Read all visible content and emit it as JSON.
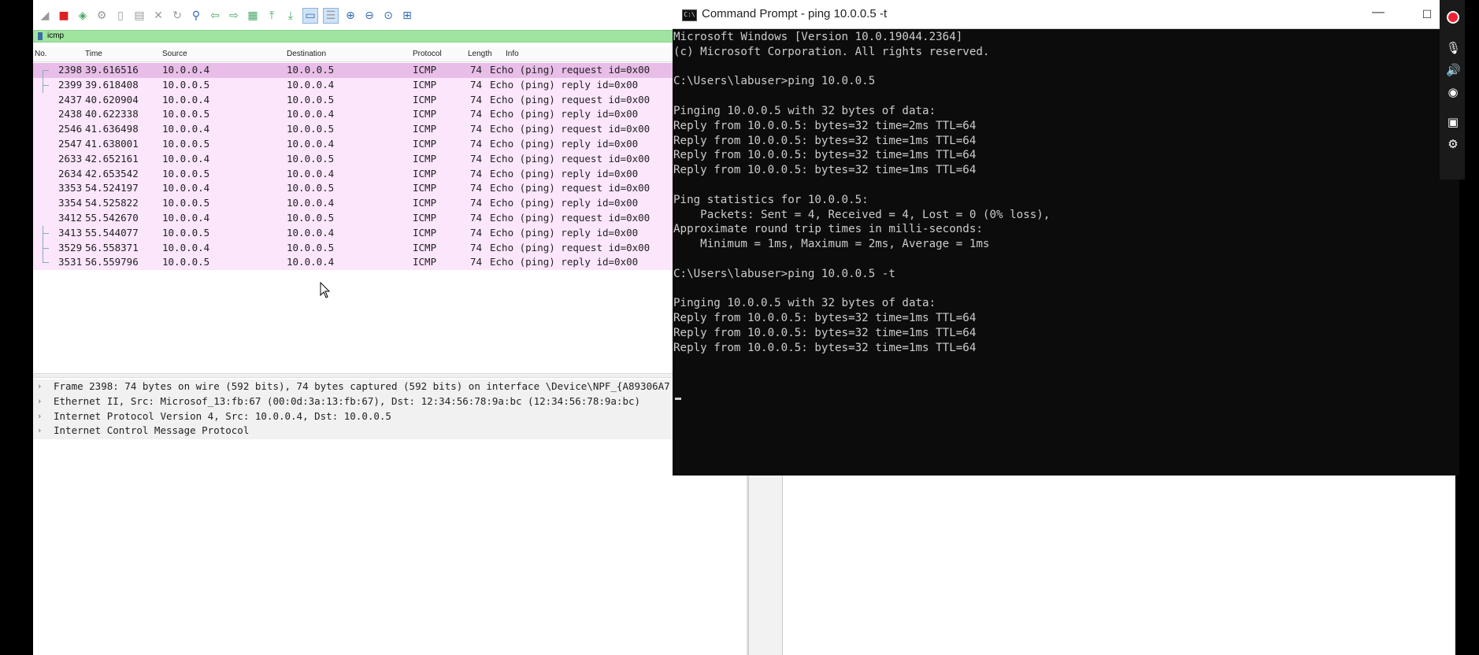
{
  "wireshark": {
    "filter": "icmp",
    "columns": {
      "no": "No.",
      "time": "Time",
      "source": "Source",
      "destination": "Destination",
      "protocol": "Protocol",
      "length": "Length",
      "info": "Info"
    },
    "packets": [
      {
        "no": "2398",
        "time": "39.616516",
        "src": "10.0.0.4",
        "dst": "10.0.0.5",
        "proto": "ICMP",
        "len": "74",
        "info": "Echo (ping) request  id=0x00"
      },
      {
        "no": "2399",
        "time": "39.618408",
        "src": "10.0.0.5",
        "dst": "10.0.0.4",
        "proto": "ICMP",
        "len": "74",
        "info": "Echo (ping) reply    id=0x00"
      },
      {
        "no": "2437",
        "time": "40.620904",
        "src": "10.0.0.4",
        "dst": "10.0.0.5",
        "proto": "ICMP",
        "len": "74",
        "info": "Echo (ping) request  id=0x00"
      },
      {
        "no": "2438",
        "time": "40.622338",
        "src": "10.0.0.5",
        "dst": "10.0.0.4",
        "proto": "ICMP",
        "len": "74",
        "info": "Echo (ping) reply    id=0x00"
      },
      {
        "no": "2546",
        "time": "41.636498",
        "src": "10.0.0.4",
        "dst": "10.0.0.5",
        "proto": "ICMP",
        "len": "74",
        "info": "Echo (ping) request  id=0x00"
      },
      {
        "no": "2547",
        "time": "41.638001",
        "src": "10.0.0.5",
        "dst": "10.0.0.4",
        "proto": "ICMP",
        "len": "74",
        "info": "Echo (ping) reply    id=0x00"
      },
      {
        "no": "2633",
        "time": "42.652161",
        "src": "10.0.0.4",
        "dst": "10.0.0.5",
        "proto": "ICMP",
        "len": "74",
        "info": "Echo (ping) request  id=0x00"
      },
      {
        "no": "2634",
        "time": "42.653542",
        "src": "10.0.0.5",
        "dst": "10.0.0.4",
        "proto": "ICMP",
        "len": "74",
        "info": "Echo (ping) reply    id=0x00"
      },
      {
        "no": "3353",
        "time": "54.524197",
        "src": "10.0.0.4",
        "dst": "10.0.0.5",
        "proto": "ICMP",
        "len": "74",
        "info": "Echo (ping) request  id=0x00"
      },
      {
        "no": "3354",
        "time": "54.525822",
        "src": "10.0.0.5",
        "dst": "10.0.0.4",
        "proto": "ICMP",
        "len": "74",
        "info": "Echo (ping) reply    id=0x00"
      },
      {
        "no": "3412",
        "time": "55.542670",
        "src": "10.0.0.4",
        "dst": "10.0.0.5",
        "proto": "ICMP",
        "len": "74",
        "info": "Echo (ping) request  id=0x00"
      },
      {
        "no": "3413",
        "time": "55.544077",
        "src": "10.0.0.5",
        "dst": "10.0.0.4",
        "proto": "ICMP",
        "len": "74",
        "info": "Echo (ping) reply    id=0x00"
      },
      {
        "no": "3529",
        "time": "56.558371",
        "src": "10.0.0.4",
        "dst": "10.0.0.5",
        "proto": "ICMP",
        "len": "74",
        "info": "Echo (ping) request  id=0x00"
      },
      {
        "no": "3531",
        "time": "56.559796",
        "src": "10.0.0.5",
        "dst": "10.0.0.4",
        "proto": "ICMP",
        "len": "74",
        "info": "Echo (ping) reply    id=0x00"
      }
    ],
    "details": [
      "Frame 2398: 74 bytes on wire (592 bits), 74 bytes captured (592 bits) on interface \\Device\\NPF_{A89306A7",
      "Ethernet II, Src: Microsof_13:fb:67 (00:0d:3a:13:fb:67), Dst: 12:34:56:78:9a:bc (12:34:56:78:9a:bc)",
      "Internet Protocol Version 4, Src: 10.0.0.4, Dst: 10.0.0.5",
      "Internet Control Message Protocol"
    ]
  },
  "cmd": {
    "icon_text": "C:\\",
    "title": "Command Prompt - ping  10.0.0.5 -t",
    "minimize": "—",
    "maximize": "☐",
    "lines": [
      "Microsoft Windows [Version 10.0.19044.2364]",
      "(c) Microsoft Corporation. All rights reserved.",
      "",
      "C:\\Users\\labuser>ping 10.0.0.5",
      "",
      "Pinging 10.0.0.5 with 32 bytes of data:",
      "Reply from 10.0.0.5: bytes=32 time=2ms TTL=64",
      "Reply from 10.0.0.5: bytes=32 time=1ms TTL=64",
      "Reply from 10.0.0.5: bytes=32 time=1ms TTL=64",
      "Reply from 10.0.0.5: bytes=32 time=1ms TTL=64",
      "",
      "Ping statistics for 10.0.0.5:",
      "    Packets: Sent = 4, Received = 4, Lost = 0 (0% loss),",
      "Approximate round trip times in milli-seconds:",
      "    Minimum = 1ms, Maximum = 2ms, Average = 1ms",
      "",
      "C:\\Users\\labuser>ping 10.0.0.5 -t",
      "",
      "Pinging 10.0.0.5 with 32 bytes of data:",
      "Reply from 10.0.0.5: bytes=32 time=1ms TTL=64",
      "Reply from 10.0.0.5: bytes=32 time=1ms TTL=64",
      "Reply from 10.0.0.5: bytes=32 time=1ms TTL=64"
    ]
  },
  "toolbar_icons": [
    "shark-fin-icon",
    "stop-icon",
    "restart-icon",
    "options-icon",
    "open-icon",
    "save-icon",
    "close-icon",
    "reload-icon",
    "find-icon",
    "back-icon",
    "forward-icon",
    "goto-icon",
    "first-icon",
    "last-icon",
    "autoscroll-icon",
    "colorize-icon",
    "zoom-in-icon",
    "zoom-out-icon",
    "zoom-normal-icon",
    "resize-columns-icon"
  ],
  "side_icons": [
    "record-icon",
    "microphone-icon",
    "speaker-icon",
    "webcam-icon",
    "screen-icon",
    "settings-icon"
  ],
  "colors": {
    "row_bg": "#fce6fc",
    "row_selected": "#e8bde8",
    "filter_ok": "#9fe59f",
    "console_fg": "#cccccc",
    "console_bg": "#0c0c0c"
  }
}
